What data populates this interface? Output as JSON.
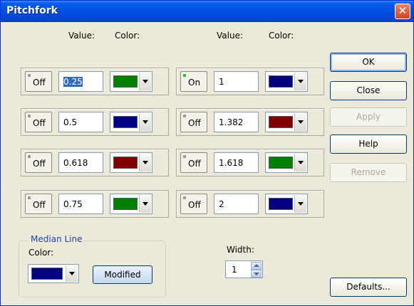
{
  "window": {
    "title": "Pitchfork",
    "close_glyph": "✕"
  },
  "headers": {
    "value": "Value:",
    "color": "Color:"
  },
  "levels": [
    {
      "state": "Off",
      "value": "0.25",
      "color": "#008000",
      "selected": true
    },
    {
      "state": "Off",
      "value": "0.5",
      "color": "#000080"
    },
    {
      "state": "Off",
      "value": "0.618",
      "color": "#800000"
    },
    {
      "state": "Off",
      "value": "0.75",
      "color": "#008000"
    },
    {
      "state": "On",
      "value": "1",
      "color": "#000080"
    },
    {
      "state": "Off",
      "value": "1.382",
      "color": "#800000"
    },
    {
      "state": "Off",
      "value": "1.618",
      "color": "#008000"
    },
    {
      "state": "Off",
      "value": "2",
      "color": "#000080"
    }
  ],
  "buttons": {
    "ok": "OK",
    "close": "Close",
    "apply": "Apply",
    "help": "Help",
    "remove": "Remove",
    "defaults": "Defaults..."
  },
  "median": {
    "title": "Median Line",
    "color_label": "Color:",
    "color": "#000080",
    "modified_label": "Modified"
  },
  "width": {
    "label": "Width:",
    "value": "1"
  }
}
